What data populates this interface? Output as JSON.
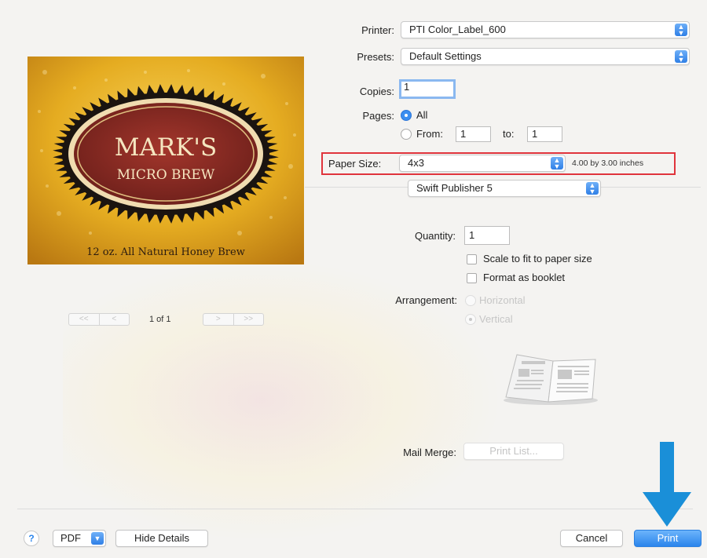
{
  "printer": {
    "label": "Printer:",
    "value": "PTI Color_Label_600"
  },
  "presets": {
    "label": "Presets:",
    "value": "Default Settings"
  },
  "copies": {
    "label": "Copies:",
    "value": "1"
  },
  "pages": {
    "label": "Pages:",
    "all_label": "All",
    "from_label": "From:",
    "from_value": "1",
    "to_label": "to:",
    "to_value": "1"
  },
  "paper_size": {
    "label": "Paper Size:",
    "value": "4x3",
    "dimensions": "4.00 by 3.00 inches"
  },
  "app_menu": {
    "value": "Swift Publisher 5"
  },
  "quantity": {
    "label": "Quantity:",
    "value": "1"
  },
  "options": {
    "scale_label": "Scale to fit to paper size",
    "booklet_label": "Format as booklet"
  },
  "arrangement": {
    "label": "Arrangement:",
    "horizontal_label": "Horizontal",
    "vertical_label": "Vertical"
  },
  "mail_merge": {
    "label": "Mail Merge:",
    "button_label": "Print List..."
  },
  "preview": {
    "label_title_line1": "MARK'S",
    "label_title_line2": "MICRO BREW",
    "label_tagline": "12 oz. All Natural Honey Brew",
    "page_indicator": "1 of 1",
    "first_glyph": "<<",
    "prev_glyph": "<",
    "next_glyph": ">",
    "last_glyph": ">>"
  },
  "footer": {
    "help_glyph": "?",
    "pdf_label": "PDF",
    "hide_details_label": "Hide Details",
    "cancel_label": "Cancel",
    "print_label": "Print"
  },
  "colors": {
    "highlight_box": "#e0343c",
    "callout_arrow": "#1a8fd8",
    "accent": "#2b85ec",
    "label_gold": "#e8b62a",
    "label_maroon": "#8a2a24"
  }
}
